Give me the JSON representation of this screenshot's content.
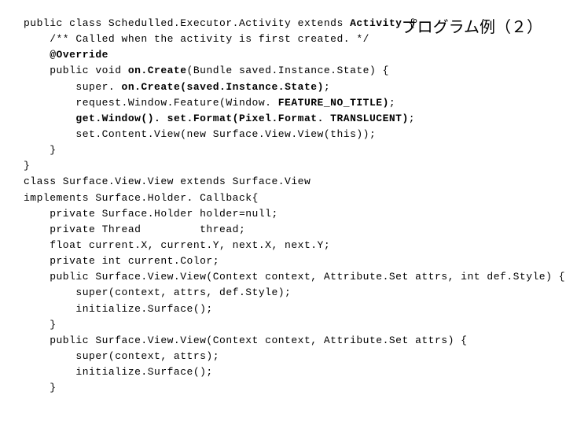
{
  "title": "プログラム例（２）",
  "code": {
    "l1a": "public class Schedulled.Executor.Activity extends ",
    "l1b": "Activity",
    "l1c": " {",
    "l2": "    /** Called when the activity is first created. */",
    "l3a": "    ",
    "l3b": "@Override",
    "l4a": "    public void ",
    "l4b": "on.Create",
    "l4c": "(Bundle saved.Instance.State) {",
    "l5a": "        super. ",
    "l5b": "on.Create(saved.Instance.State)",
    "l5c": ";",
    "l6a": "        request.Window.Feature(Window. ",
    "l6b": "FEATURE_NO_TITLE)",
    "l6c": ";",
    "l7a": "        ",
    "l7b": "get.Window(). set.Format(Pixel.Format. TRANSLUCENT)",
    "l7c": ";",
    "l8": "        set.Content.View(new Surface.View.View(this));",
    "l9": "    }",
    "l10": "}",
    "l11": "class Surface.View.View extends Surface.View",
    "l12": "implements Surface.Holder. Callback{",
    "l13": "    private Surface.Holder holder=null;",
    "l14": "    private Thread         thread;",
    "l15": "    float current.X, current.Y, next.X, next.Y;",
    "l16": "    private int current.Color;",
    "l17": "    public Surface.View.View(Context context, Attribute.Set attrs, int def.Style) {",
    "l18": "        super(context, attrs, def.Style);",
    "l19": "        initialize.Surface();",
    "l20": "    }",
    "l21": "    public Surface.View.View(Context context, Attribute.Set attrs) {",
    "l22": "        super(context, attrs);",
    "l23": "        initialize.Surface();",
    "l24": "    }"
  }
}
